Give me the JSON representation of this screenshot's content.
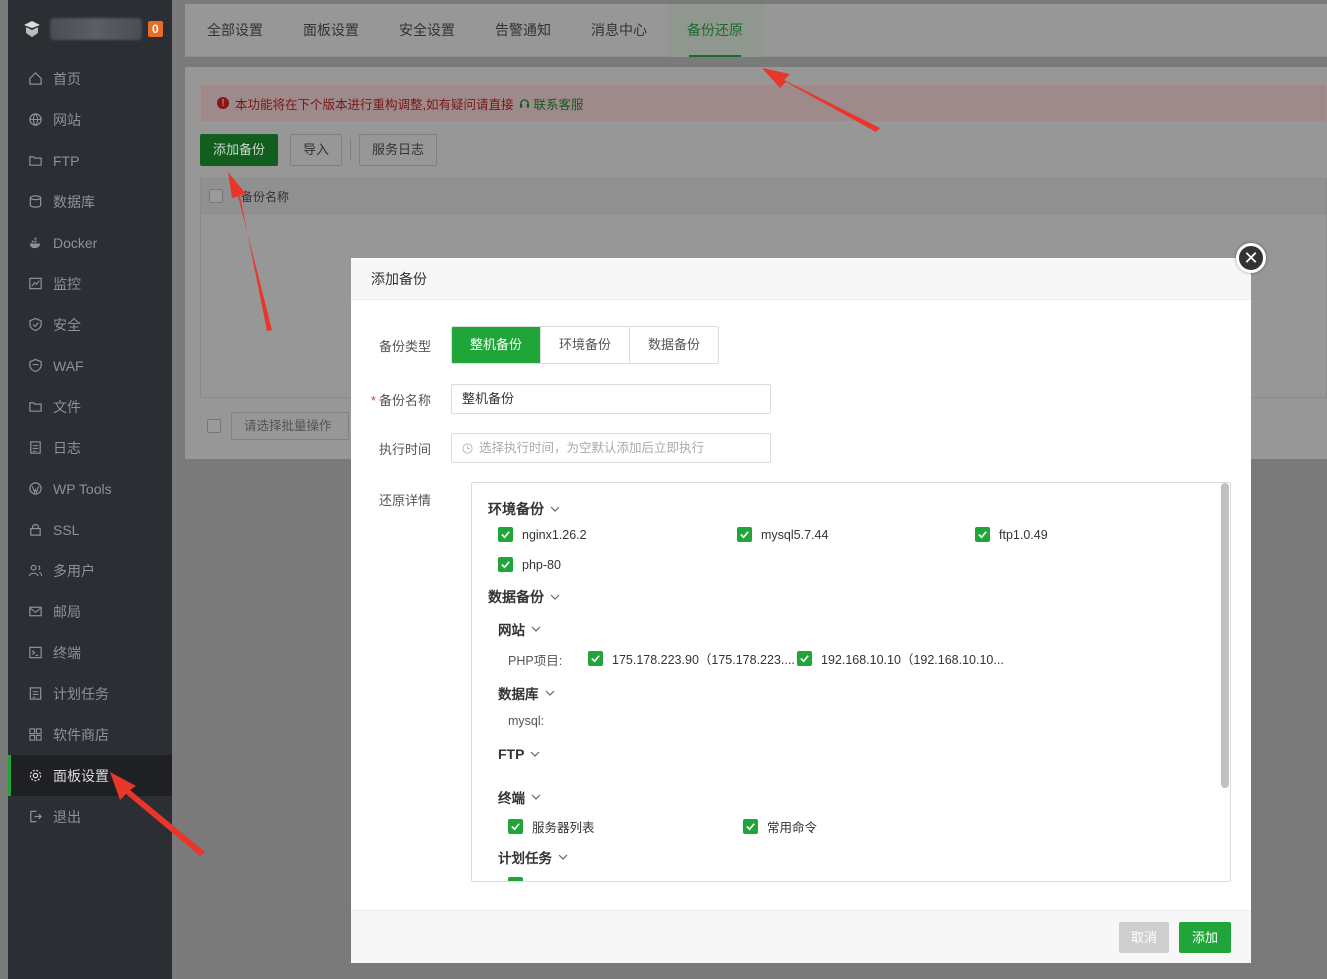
{
  "sidebar": {
    "badge": "0",
    "items": [
      {
        "label": "首页",
        "icon": "home-icon"
      },
      {
        "label": "网站",
        "icon": "globe-icon"
      },
      {
        "label": "FTP",
        "icon": "ftp-folder-icon"
      },
      {
        "label": "数据库",
        "icon": "database-icon"
      },
      {
        "label": "Docker",
        "icon": "docker-icon"
      },
      {
        "label": "监控",
        "icon": "monitor-chart-icon"
      },
      {
        "label": "安全",
        "icon": "shield-icon"
      },
      {
        "label": "WAF",
        "icon": "waf-shield-icon"
      },
      {
        "label": "文件",
        "icon": "folder-icon"
      },
      {
        "label": "日志",
        "icon": "log-icon"
      },
      {
        "label": "WP Tools",
        "icon": "wordpress-icon"
      },
      {
        "label": "SSL",
        "icon": "ssl-icon"
      },
      {
        "label": "多用户",
        "icon": "users-icon"
      },
      {
        "label": "邮局",
        "icon": "mail-icon"
      },
      {
        "label": "终端",
        "icon": "terminal-icon"
      },
      {
        "label": "计划任务",
        "icon": "calendar-task-icon"
      },
      {
        "label": "软件商店",
        "icon": "grid-store-icon"
      },
      {
        "label": "面板设置",
        "icon": "gear-icon"
      },
      {
        "label": "退出",
        "icon": "logout-icon"
      }
    ]
  },
  "tabs": [
    "全部设置",
    "面板设置",
    "安全设置",
    "告警通知",
    "消息中心",
    "备份还原"
  ],
  "alert": {
    "text": "本功能将在下个版本进行重构调整,如有疑问请直接",
    "link": "联系客服"
  },
  "toolbar": {
    "add": "添加备份",
    "import": "导入",
    "log": "服务日志"
  },
  "table": {
    "col_name": "备份名称"
  },
  "batch": {
    "placeholder": "请选择批量操作"
  },
  "modal": {
    "title": "添加备份",
    "type_label": "备份类型",
    "types": [
      "整机备份",
      "环境备份",
      "数据备份"
    ],
    "name_label": "备份名称",
    "name_value": "整机备份",
    "time_label": "执行时间",
    "time_placeholder": "选择执行时间，为空默认添加后立即执行",
    "detail_label": "还原详情",
    "env_title": "环境备份",
    "env_items": [
      "nginx1.26.2",
      "mysql5.7.44",
      "ftp1.0.49",
      "php-80"
    ],
    "data_title": "数据备份",
    "site_title": "网站",
    "php_label": "PHP项目:",
    "sites": [
      "175.178.223.90（175.178.223....",
      "192.168.10.10（192.168.10.10..."
    ],
    "db_title": "数据库",
    "mysql_label": "mysql:",
    "ftp_title": "FTP",
    "term_title": "终端",
    "term_items": [
      "服务器列表",
      "常用命令"
    ],
    "cron_title": "计划任务",
    "cancel": "取消",
    "add": "添加"
  }
}
